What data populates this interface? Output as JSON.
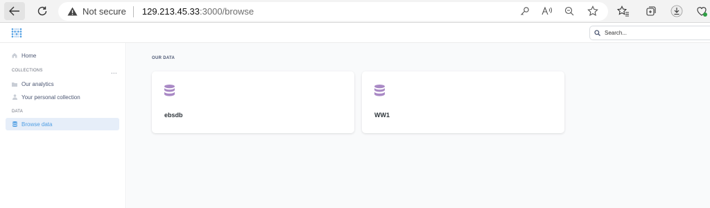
{
  "browser": {
    "security_label": "Not secure",
    "url_host": "129.213.45.33",
    "url_path": ":3000/browse"
  },
  "app": {
    "search_placeholder": "Search..."
  },
  "sidebar": {
    "home_label": "Home",
    "collections_heading": "COLLECTIONS",
    "collections_more": "...",
    "collections": [
      {
        "label": "Our analytics"
      },
      {
        "label": "Your personal collection"
      }
    ],
    "data_heading": "DATA",
    "browse_label": "Browse data"
  },
  "main": {
    "section_title": "OUR DATA",
    "databases": [
      {
        "name": "ebsdb"
      },
      {
        "name": "WW1"
      }
    ]
  },
  "colors": {
    "brand": "#509ee3",
    "db_icon": "#a989c5",
    "active_bg": "#e6eef9"
  }
}
